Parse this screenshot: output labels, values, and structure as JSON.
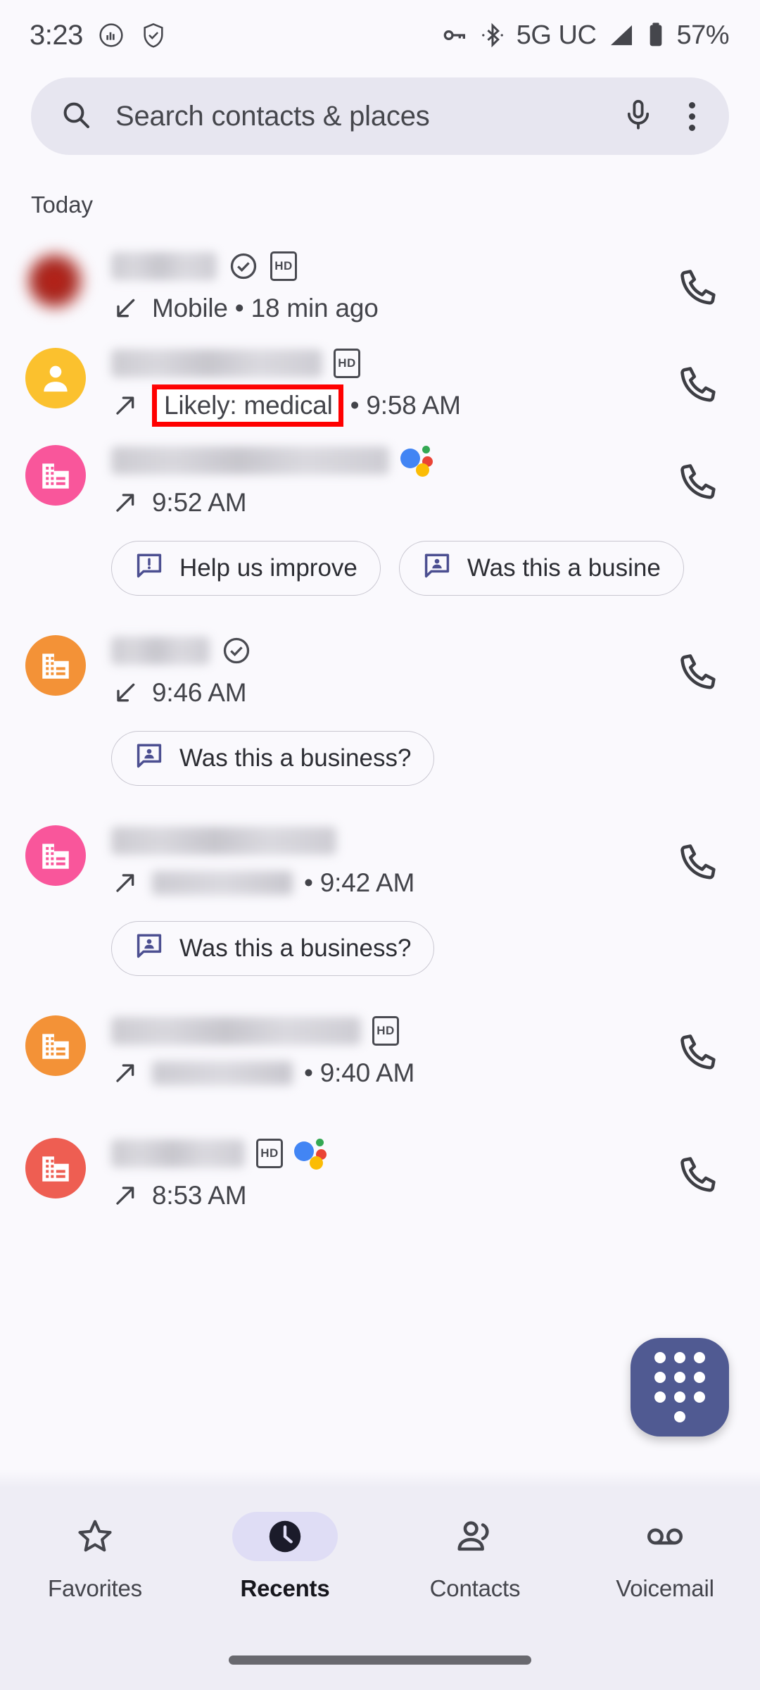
{
  "statusbar": {
    "time": "3:23",
    "icons_left": [
      "signal-bars-circle-icon",
      "shield-check-icon"
    ],
    "icons_right": [
      "key-icon",
      "bluetooth-icon",
      "cell-signal-icon",
      "battery-icon"
    ],
    "network": "5G UC",
    "battery": "57%"
  },
  "search": {
    "placeholder": "Search contacts & places",
    "search_icon": "search-icon",
    "mic_icon": "microphone-icon",
    "overflow_icon": "more-vert-icon"
  },
  "list": {
    "section_header": "Today",
    "entries": [
      {
        "avatar_type": "photo-blurred",
        "avatar_color": "#B4251A",
        "name_redacted": true,
        "name_width": 150,
        "badges": [
          "verified-icon",
          "hd-badge"
        ],
        "direction": "incoming",
        "subtitle_prefix": "Mobile",
        "has_separator": true,
        "time": "18 min ago",
        "chips": []
      },
      {
        "avatar_type": "person",
        "avatar_color": "#FBC12E",
        "name_redacted": true,
        "name_width": 300,
        "badges": [
          "hd-badge"
        ],
        "direction": "outgoing",
        "highlight_label": "Likely: medical",
        "highlighted": true,
        "has_separator": true,
        "time": "9:58 AM",
        "chips": []
      },
      {
        "avatar_type": "business",
        "avatar_color": "#F9569B",
        "name_redacted": true,
        "name_width": 395,
        "badges": [
          "assistant-dots-icon"
        ],
        "direction": "outgoing",
        "has_separator": false,
        "time": "9:52 AM",
        "chips": [
          "Help us improve",
          "Was this a busine"
        ]
      },
      {
        "avatar_type": "business",
        "avatar_color": "#F39237",
        "name_redacted": true,
        "name_width": 140,
        "badges": [
          "verified-icon"
        ],
        "direction": "incoming",
        "has_separator": false,
        "time": "9:46 AM",
        "chips": [
          "Was this a business?"
        ]
      },
      {
        "avatar_type": "business",
        "avatar_color": "#F9569B",
        "name_redacted": true,
        "name_width": 320,
        "badges": [],
        "direction": "outgoing",
        "location_redacted": true,
        "has_separator": true,
        "time": "9:42 AM",
        "chips": [
          "Was this a business?"
        ]
      },
      {
        "avatar_type": "business",
        "avatar_color": "#F39237",
        "name_redacted": true,
        "name_width": 355,
        "badges": [
          "hd-badge"
        ],
        "direction": "outgoing",
        "location_redacted": true,
        "has_separator": true,
        "time": "9:40 AM",
        "chips": []
      },
      {
        "avatar_type": "business",
        "avatar_color": "#EE5E52",
        "name_redacted": true,
        "name_width": 190,
        "badges": [
          "hd-badge",
          "assistant-dots-icon"
        ],
        "direction": "outgoing",
        "has_separator": false,
        "time": "8:53 AM",
        "chips": []
      }
    ],
    "call_button_icon": "phone-call-icon",
    "chip_icons": {
      "feedback": "feedback-chat-icon",
      "business": "person-chat-icon"
    }
  },
  "fab": {
    "icon": "dialpad-icon",
    "color": "#505A92"
  },
  "bottom_nav": {
    "items": [
      {
        "label": "Favorites",
        "icon": "star-icon",
        "active": false
      },
      {
        "label": "Recents",
        "icon": "clock-icon",
        "active": true
      },
      {
        "label": "Contacts",
        "icon": "contacts-icon",
        "active": false
      },
      {
        "label": "Voicemail",
        "icon": "voicemail-icon",
        "active": false
      }
    ]
  },
  "annotation": {
    "type": "red-rectangle-highlight",
    "color": "#FF0000",
    "target_text": "Likely: medical"
  },
  "theme": {
    "background": "#FAF9FD",
    "search_bg": "#E7E6F0",
    "nav_bg": "#EEEDF5",
    "active_pill": "#DFDDF5",
    "text": "#1F1F24"
  }
}
